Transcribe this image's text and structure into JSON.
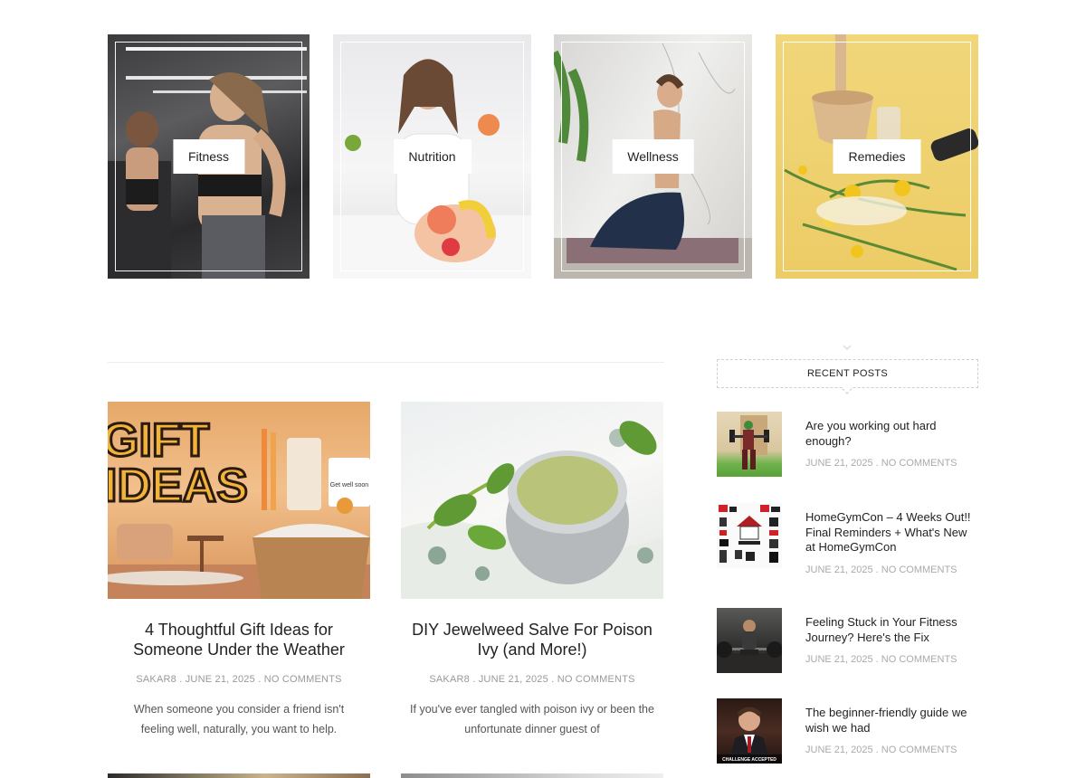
{
  "categories": [
    {
      "label": "Fitness"
    },
    {
      "label": "Nutrition"
    },
    {
      "label": "Wellness"
    },
    {
      "label": "Remedies"
    }
  ],
  "posts": [
    {
      "title": "4 Thoughtful Gift Ideas for Someone Under the Weather",
      "author": "SAKAR8",
      "date": "JUNE 21, 2025",
      "comments": "NO COMMENTS",
      "excerpt": "When someone you consider a friend isn't feeling well, naturally, you want to help.",
      "thumb_text": {
        "line1": "GIFT",
        "line2": "IDEAS",
        "card": "Get well soon"
      }
    },
    {
      "title": "DIY Jewelweed Salve For Poison Ivy (and More!)",
      "author": "SAKAR8",
      "date": "JUNE 21, 2025",
      "comments": "NO COMMENTS",
      "excerpt": "If you've ever tangled with poison ivy or been the unfortunate dinner guest of"
    }
  ],
  "separator": ".",
  "sidebar": {
    "heading": "RECENT POSTS",
    "posts": [
      {
        "title": "Are you working out hard enough?",
        "date": "JUNE 21, 2025",
        "comments": "NO COMMENTS"
      },
      {
        "title": "HomeGymCon – 4 Weeks Out!! Final Reminders + What's New at HomeGymCon",
        "date": "JUNE 21, 2025",
        "comments": "NO COMMENTS"
      },
      {
        "title": "Feeling Stuck in Your Fitness Journey? Here's the Fix",
        "date": "JUNE 21, 2025",
        "comments": "NO COMMENTS"
      },
      {
        "title": "The beginner-friendly guide we wish we had",
        "date": "JUNE 21, 2025",
        "comments": "NO COMMENTS",
        "thumb_caption": "CHALLENGE ACCEPTED"
      }
    ]
  },
  "colors": {
    "accent_text": "#222222",
    "meta_text": "#999999",
    "divider": "#ececec",
    "remedies_bg": "#eccc66"
  }
}
